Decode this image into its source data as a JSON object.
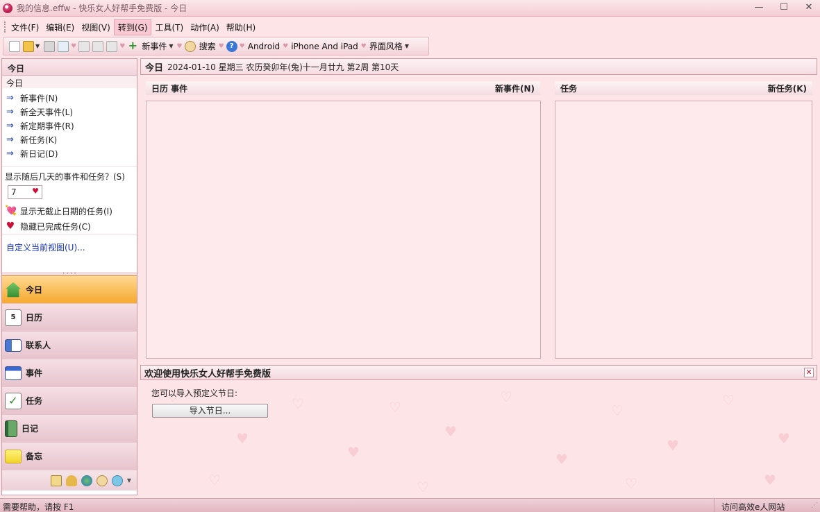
{
  "window": {
    "title": "我的信息.effw - 快乐女人好帮手免费版 - 今日",
    "minimize_glyph": "—",
    "maximize_glyph": "☐",
    "close_glyph": "✕"
  },
  "menu": [
    {
      "label": "文件(F)"
    },
    {
      "label": "编辑(E)"
    },
    {
      "label": "视图(V)"
    },
    {
      "label": "转到(G)"
    },
    {
      "label": "工具(T)"
    },
    {
      "label": "动作(A)"
    },
    {
      "label": "帮助(H)"
    }
  ],
  "toolbar": {
    "new_event": "新事件",
    "search": "搜索",
    "android": "Android",
    "iphone": "iPhone And iPad",
    "theme": "界面风格"
  },
  "left_panel": {
    "header": "今日",
    "subheader": "今日",
    "links": [
      {
        "label": "新事件(N)"
      },
      {
        "label": "新全天事件(L)"
      },
      {
        "label": "新定期事件(R)"
      },
      {
        "label": "新任务(K)"
      },
      {
        "label": "新日记(D)"
      }
    ],
    "days_question": "显示随后几天的事件和任务？(S)",
    "days_value": "7",
    "show_no_due": "显示无截止日期的任务(I)",
    "hide_completed": "隐藏已完成任务(C)",
    "customize": "自定义当前视图(U)..."
  },
  "nav": [
    {
      "label": "今日",
      "icon": "home-icon",
      "active": true
    },
    {
      "label": "日历",
      "icon": "calendar-icon",
      "active": false
    },
    {
      "label": "联系人",
      "icon": "contacts-icon",
      "active": false
    },
    {
      "label": "事件",
      "icon": "events-icon",
      "active": false
    },
    {
      "label": "任务",
      "icon": "tasks-icon",
      "active": false
    },
    {
      "label": "日记",
      "icon": "diary-icon",
      "active": false
    },
    {
      "label": "备忘",
      "icon": "memo-icon",
      "active": false
    }
  ],
  "main": {
    "title": "今日",
    "date_line": "2024-01-10 星期三 农历癸卯年(兔)十一月廿九   第2周 第10天",
    "calendar_panel": {
      "left": "日历   事件",
      "right": "新事件(N)"
    },
    "task_panel": {
      "left": "任务",
      "right": "新任务(K)"
    }
  },
  "welcome": {
    "title": "欢迎使用快乐女人好帮手免费版",
    "text": "您可以导入预定义节日:",
    "button": "导入节日..."
  },
  "statusbar": {
    "left": "需要帮助，请按 F1",
    "right": "访问高效e人网站"
  },
  "colors": {
    "background": "#fde4e6",
    "accent_active": "#f6a92e",
    "border": "#c99aa6",
    "link": "#1330b0"
  }
}
